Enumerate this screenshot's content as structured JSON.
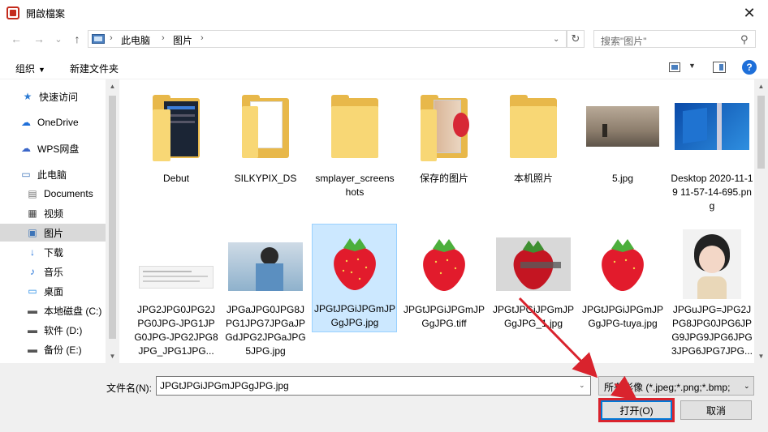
{
  "window": {
    "title": "開啟檔案",
    "close_glyph": "✕"
  },
  "nav": {
    "back_glyph": "←",
    "forward_glyph": "→",
    "recent_glyph": "⌄",
    "up_glyph": "↑",
    "breadcrumb": [
      "此电脑",
      "图片"
    ],
    "crumb_sep": "›",
    "dropdown_glyph": "⌄",
    "refresh_glyph": "↻",
    "search_placeholder": "搜索\"图片\"",
    "search_glyph": "⚲"
  },
  "toolbar": {
    "organize_label": "组织",
    "organize_arrow": "▼",
    "new_folder_label": "新建文件夹",
    "view_dropdown": "▼",
    "help_label": "?"
  },
  "sidebar": {
    "items": [
      {
        "label": "快速访问",
        "icon": "★",
        "icon_name": "star-icon",
        "color": "#2c7bd3"
      },
      {
        "label": "OneDrive",
        "icon": "☁",
        "icon_name": "cloud-icon",
        "color": "#1e6fd9"
      },
      {
        "label": "WPS网盘",
        "icon": "☁",
        "icon_name": "wps-cloud-icon",
        "color": "#3a66c9"
      },
      {
        "label": "此电脑",
        "icon": "▭",
        "icon_name": "computer-icon",
        "color": "#3d74b8"
      },
      {
        "label": "Documents",
        "icon": "▤",
        "icon_name": "documents-icon",
        "color": "#777777"
      },
      {
        "label": "视频",
        "icon": "▦",
        "icon_name": "video-icon",
        "color": "#444444"
      },
      {
        "label": "图片",
        "icon": "▣",
        "icon_name": "pictures-icon",
        "color": "#3d74b8"
      },
      {
        "label": "下载",
        "icon": "↓",
        "icon_name": "download-icon",
        "color": "#1e6fd9"
      },
      {
        "label": "音乐",
        "icon": "♪",
        "icon_name": "music-icon",
        "color": "#1e6fd9"
      },
      {
        "label": "桌面",
        "icon": "▭",
        "icon_name": "desktop-icon",
        "color": "#1e88e5"
      },
      {
        "label": "本地磁盘 (C:)",
        "icon": "▬",
        "icon_name": "drive-c-icon",
        "color": "#555555"
      },
      {
        "label": "软件 (D:)",
        "icon": "▬",
        "icon_name": "drive-d-icon",
        "color": "#555555"
      },
      {
        "label": "备份 (E:)",
        "icon": "▬",
        "icon_name": "drive-e-icon",
        "color": "#555555"
      }
    ],
    "selected_index": 6,
    "scroll_up": "▲",
    "scroll_down": "▼"
  },
  "files": {
    "row1": [
      {
        "name": "Debut",
        "kind": "folder"
      },
      {
        "name": "SILKYPIX_DS",
        "kind": "folder-paper"
      },
      {
        "name": "smplayer_screenshots",
        "kind": "folder"
      },
      {
        "name": "保存的图片",
        "kind": "folder-photo"
      },
      {
        "name": "本机照片",
        "kind": "folder"
      },
      {
        "name": "5.jpg",
        "kind": "landscape"
      },
      {
        "name": "Desktop 2020-11-19 11-57-14-695.png",
        "kind": "desktop"
      }
    ],
    "row2": [
      {
        "name": "JPG2JPG0JPG2JPG0JPG-JPG1JPG0JPG-JPG2JPG8JPG_JPG1JPG...",
        "kind": "doc"
      },
      {
        "name": "JPGaJPG0JPG8JPG1JPG7JPGaJPGdJPG2JPGaJPG5JPG.jpg",
        "kind": "boy"
      },
      {
        "name": "JPGtJPGiJPGmJPGgJPG.jpg",
        "kind": "strawberry"
      },
      {
        "name": "JPGtJPGiJPGmJPGgJPG.tiff",
        "kind": "strawberry"
      },
      {
        "name": "JPGtJPGiJPGmJPGgJPG_1.jpg",
        "kind": "strawberry-dark"
      },
      {
        "name": "JPGtJPGiJPGmJPGgJPG-tuya.jpg",
        "kind": "strawberry"
      },
      {
        "name": "JPGuJPG=JPG2JPG8JPG0JPG6JPG9JPG9JPG6JPG3JPG6JPG7JPG...",
        "kind": "girl"
      }
    ],
    "selected": "JPGtJPGiJPGmJPGgJPG.jpg",
    "scroll_up": "▲",
    "scroll_down": "▼"
  },
  "bottom": {
    "filename_label": "文件名(N):",
    "filename_value": "JPGtJPGiJPGmJPGgJPG.jpg",
    "filename_dropdown": "⌄",
    "filter_value": "所有影像 (*.jpeg;*.png;*.bmp;",
    "filter_dropdown": "⌄",
    "open_label": "打开(O)",
    "cancel_label": "取消"
  },
  "colors": {
    "selection_bg": "#cce8ff",
    "accent": "#0078d7",
    "annotation_red": "#d9232d"
  }
}
